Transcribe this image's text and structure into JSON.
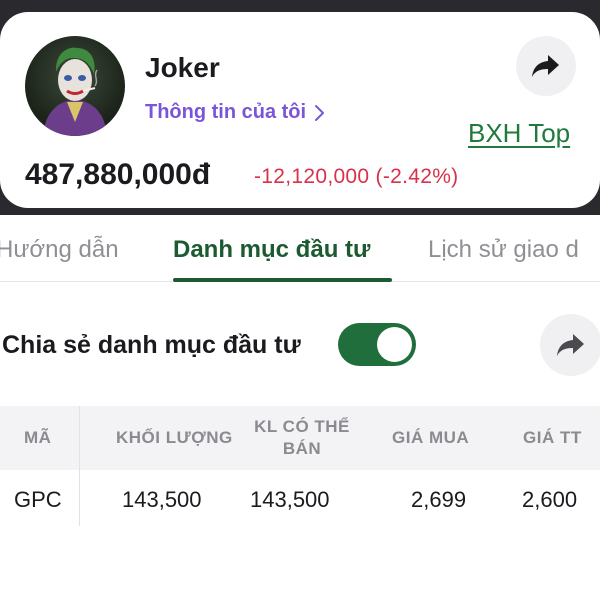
{
  "profile": {
    "name": "Joker",
    "link_label": "Thông tin của tôi",
    "ranking_link": "BXH Top",
    "balance": "487,880,000đ",
    "change": "-12,120,000 (-2.42%)",
    "share_icon": "share-arrow-icon",
    "avatar_icon": "joker-avatar"
  },
  "tabs": [
    {
      "label": "Hướng dẫn",
      "active": false
    },
    {
      "label": "Danh mục đầu tư",
      "active": true
    },
    {
      "label": "Lịch sử giao d",
      "active": false
    }
  ],
  "share_portfolio": {
    "label": "Chia sẻ danh mục đầu tư",
    "enabled": true
  },
  "table": {
    "headers": [
      "MÃ",
      "KHỐI LƯỢNG",
      "KL CÓ THỂ BÁN",
      "GIÁ MUA",
      "GIÁ TT"
    ],
    "rows": [
      [
        "GPC",
        "143,500",
        "143,500",
        "2,699",
        "2,600"
      ]
    ]
  },
  "colors": {
    "accent_green": "#1f6e3b",
    "link_purple": "#7b55d9",
    "negative_red": "#d8314a",
    "header_bg": "#f3f3f5"
  }
}
